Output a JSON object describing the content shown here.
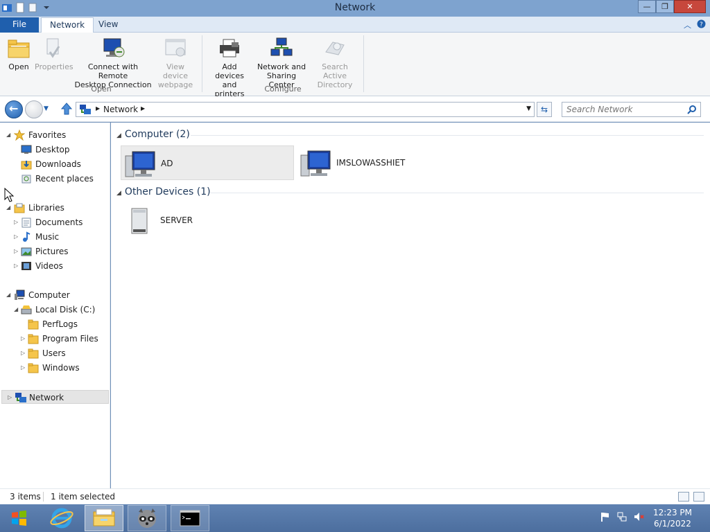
{
  "window": {
    "title": "Network",
    "minimize": "—",
    "maximize": "❐",
    "close": "✕"
  },
  "ribbon_tabs": {
    "file": "File",
    "network": "Network",
    "view": "View"
  },
  "ribbon": {
    "open": "Open",
    "properties": "Properties",
    "connect_remote": [
      "Connect with Remote",
      "Desktop Connection"
    ],
    "view_webpage": [
      "View device",
      "webpage"
    ],
    "add_devices": [
      "Add devices",
      "and printers"
    ],
    "sharing_center": [
      "Network and",
      "Sharing Center"
    ],
    "search_ad": [
      "Search Active",
      "Directory"
    ],
    "group_open": "Open",
    "group_configure": "Configure"
  },
  "address": {
    "path": "Network",
    "search_placeholder": "Search Network"
  },
  "nav": {
    "favorites": "Favorites",
    "desktop": "Desktop",
    "downloads": "Downloads",
    "recent": "Recent places",
    "libraries": "Libraries",
    "documents": "Documents",
    "music": "Music",
    "pictures": "Pictures",
    "videos": "Videos",
    "computer": "Computer",
    "local_disk": "Local Disk (C:)",
    "perflogs": "PerfLogs",
    "program_files": "Program Files",
    "users": "Users",
    "windows": "Windows",
    "network": "Network"
  },
  "content": {
    "group_computer": "Computer (2)",
    "group_other": "Other Devices (1)",
    "computers": [
      "AD",
      "IMSLOWASSHIET"
    ],
    "devices": [
      "SERVER"
    ]
  },
  "status": {
    "items": "3 items",
    "selected": "1 item selected"
  },
  "clock": {
    "time": "12:23 PM",
    "date": "6/1/2022"
  },
  "colors": {
    "accent": "#1f5fad",
    "taskbar": "#5f82b2",
    "titlebar": "#7ea3cf"
  }
}
